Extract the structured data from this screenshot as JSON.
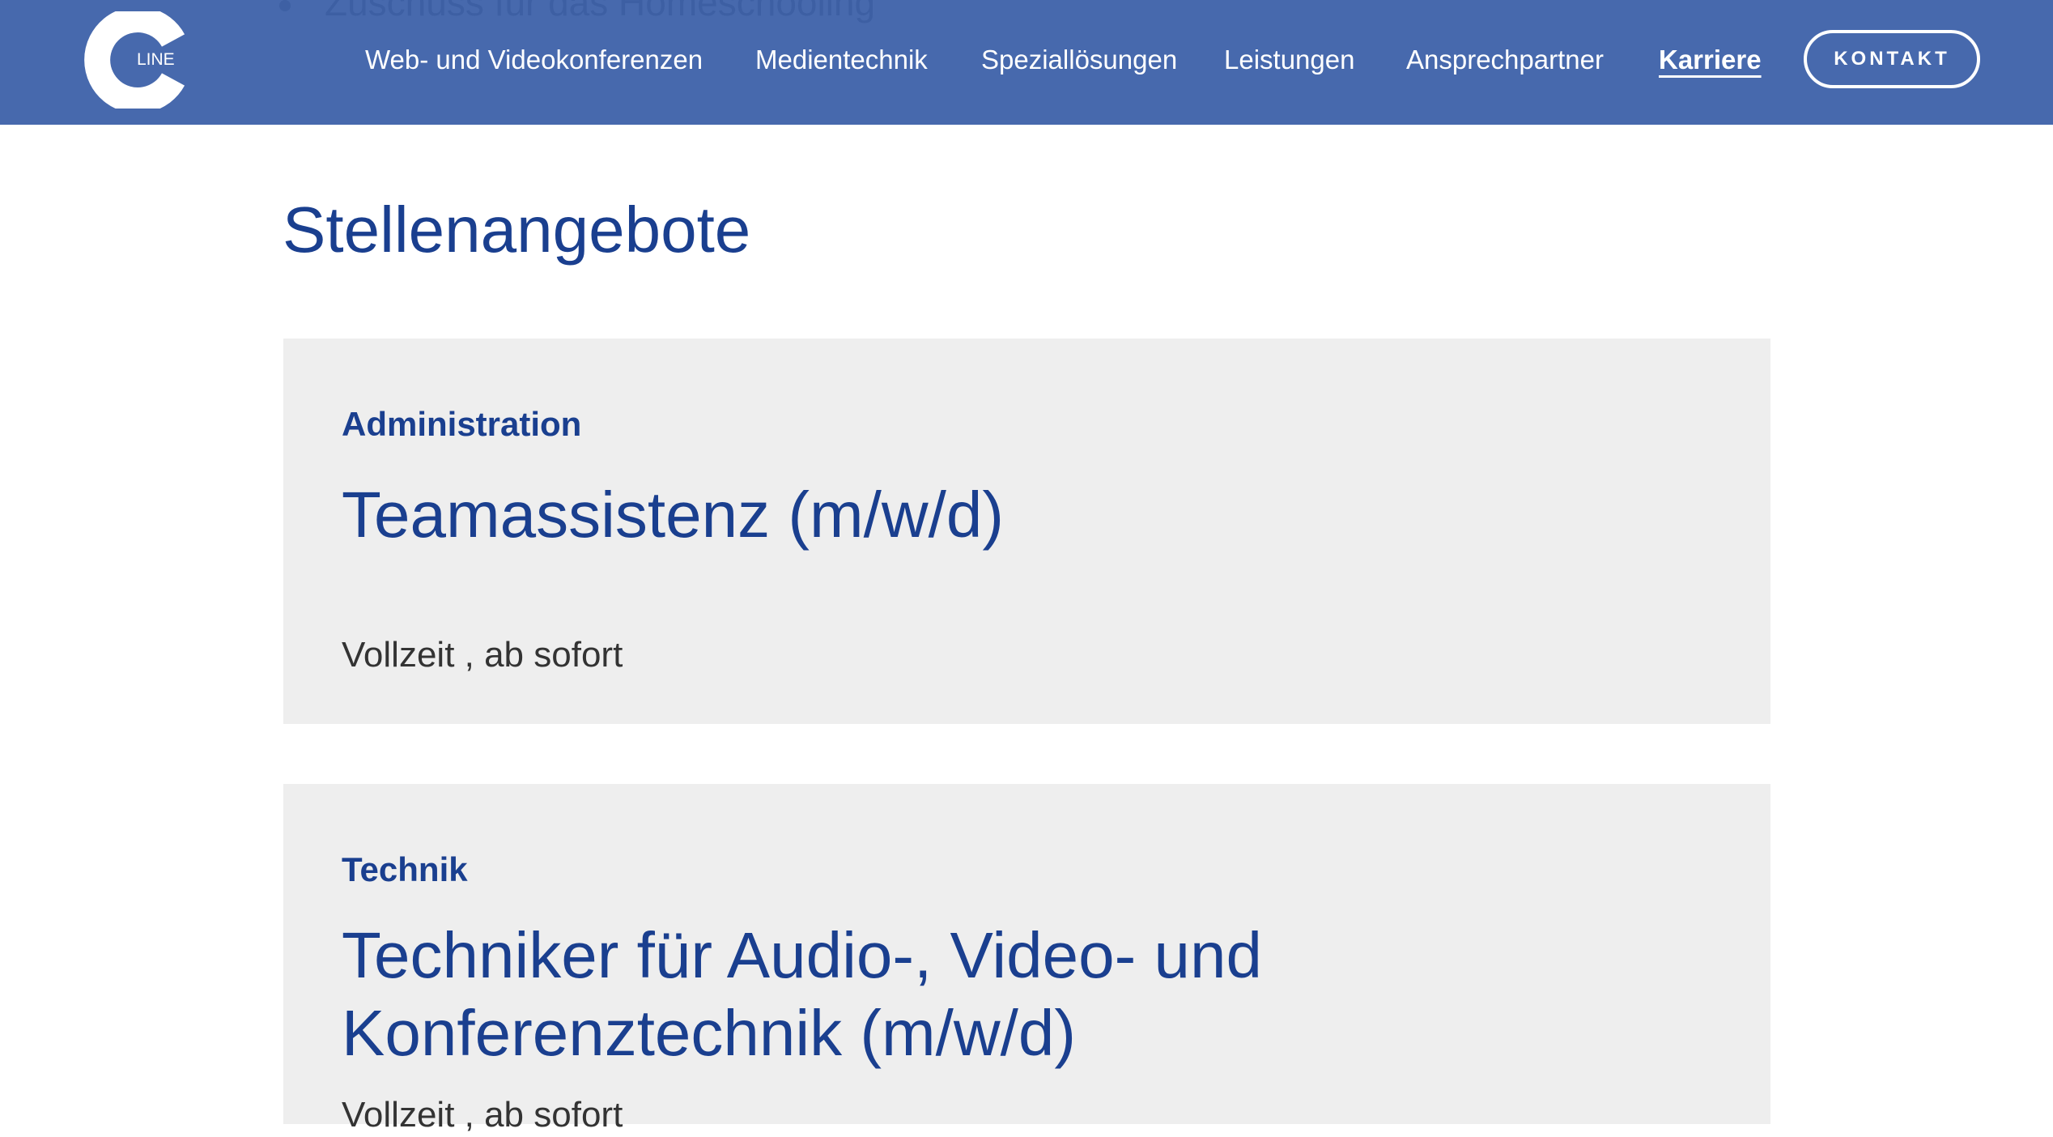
{
  "header": {
    "ghost_text": "Zuschuss für das Homeschooling",
    "logo": {
      "mark_letter": "C",
      "text": "LINE",
      "colors": {
        "mark": "#ffffff"
      }
    },
    "nav": [
      {
        "label": "Web- und Videokonferenzen",
        "active": false
      },
      {
        "label": "Medientechnik",
        "active": false
      },
      {
        "label": "Speziallösungen",
        "active": false
      },
      {
        "label": "Leistungen",
        "active": false
      },
      {
        "label": "Ansprechpartner",
        "active": false
      },
      {
        "label": "Karriere",
        "active": true
      }
    ],
    "contact_label": "KONTAKT"
  },
  "main": {
    "title": "Stellenangebote",
    "jobs": [
      {
        "category": "Administration",
        "title": "Teamassistenz (m/w/d)",
        "meta": "Vollzeit , ab sofort"
      },
      {
        "category": "Technik",
        "title": "Techniker für Audio-, Video- und Konferenztechnik (m/w/d)",
        "meta": "Vollzeit , ab sofort"
      }
    ]
  },
  "colors": {
    "header_bg": "#4769ad",
    "brand_blue": "#1a3f8f",
    "card_bg": "#eeeeee",
    "meta_text": "#333333",
    "white": "#ffffff"
  }
}
